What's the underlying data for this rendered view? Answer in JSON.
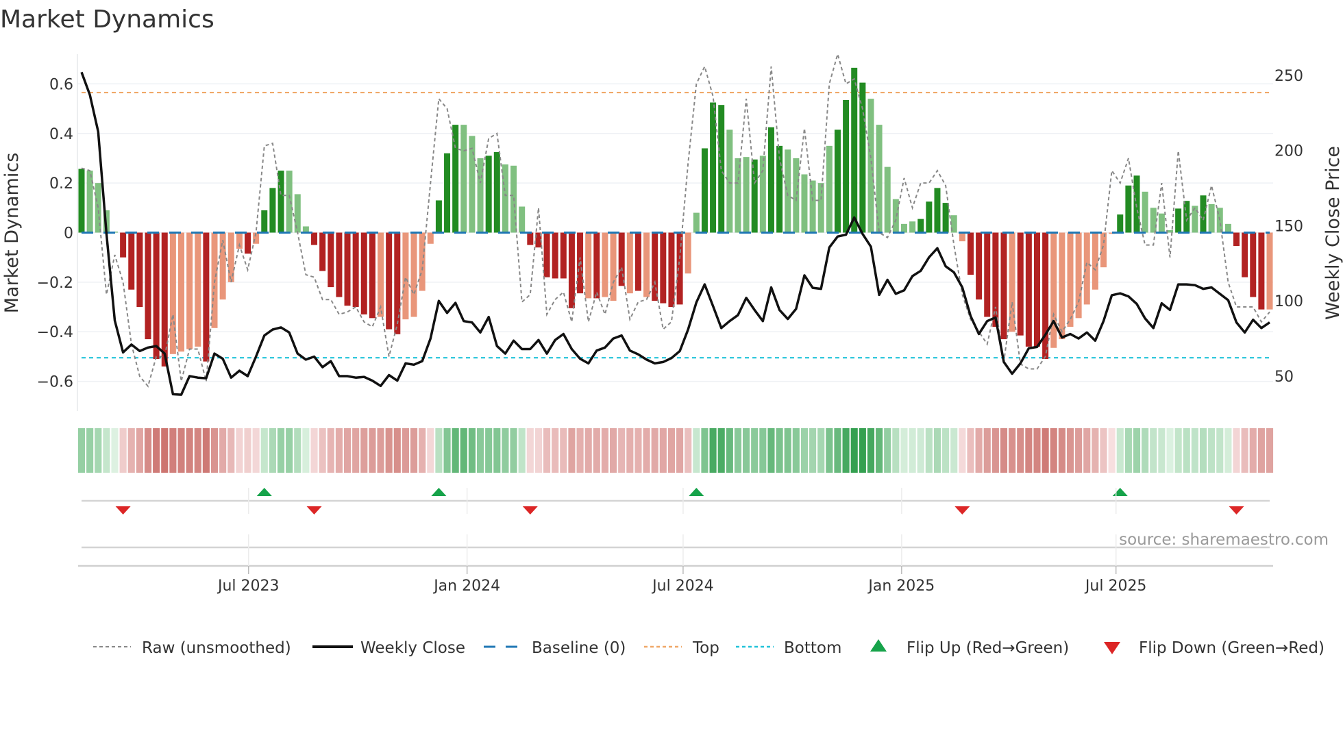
{
  "chart_data": {
    "type": "bar",
    "title": "Market Dynamics",
    "ylabel_left": "Market Dynamics",
    "ylabel_right": "Weekly Close Price",
    "ylim_left": [
      -0.72,
      0.72
    ],
    "ylim_right": [
      26.8,
      264
    ],
    "yticks_left": [
      {
        "value": 0.6,
        "label": "0.6"
      },
      {
        "value": 0.4,
        "label": "0.4"
      },
      {
        "value": 0.2,
        "label": "0.2"
      },
      {
        "value": 0,
        "label": "0"
      },
      {
        "value": -0.2,
        "label": "−0.2"
      },
      {
        "value": -0.4,
        "label": "−0.4"
      },
      {
        "value": -0.6,
        "label": "−0.6"
      }
    ],
    "yticks_right": [
      {
        "value": 50,
        "label": "50"
      },
      {
        "value": 100,
        "label": "100"
      },
      {
        "value": 150,
        "label": "150"
      },
      {
        "value": 200,
        "label": "200"
      },
      {
        "value": 250,
        "label": "250"
      }
    ],
    "x_unit": "week index",
    "x_ticks": [
      {
        "label": "Jul 2023",
        "week": 20.1
      },
      {
        "label": "Jan 2024",
        "week": 46.4
      },
      {
        "label": "Jul 2024",
        "week": 72.4
      },
      {
        "label": "Jan 2025",
        "week": 98.7
      },
      {
        "label": "Jul 2025",
        "week": 124.5
      }
    ],
    "grid": true,
    "momentum": [
      0.257,
      0.25,
      0.2,
      0.09,
      0.004,
      -0.1,
      -0.23,
      -0.3,
      -0.43,
      -0.51,
      -0.54,
      -0.49,
      -0.48,
      -0.47,
      -0.46,
      -0.52,
      -0.385,
      -0.27,
      -0.2,
      -0.065,
      -0.085,
      -0.045,
      0.09,
      0.18,
      0.25,
      0.25,
      0.155,
      0.025,
      -0.05,
      -0.155,
      -0.22,
      -0.26,
      -0.295,
      -0.3,
      -0.33,
      -0.345,
      -0.34,
      -0.39,
      -0.41,
      -0.35,
      -0.34,
      -0.235,
      -0.045,
      0.13,
      0.32,
      0.435,
      0.435,
      0.39,
      0.3,
      0.31,
      0.325,
      0.275,
      0.27,
      0.105,
      -0.05,
      -0.06,
      -0.18,
      -0.185,
      -0.185,
      -0.305,
      -0.245,
      -0.265,
      -0.265,
      -0.26,
      -0.275,
      -0.215,
      -0.245,
      -0.235,
      -0.26,
      -0.275,
      -0.285,
      -0.3,
      -0.29,
      -0.165,
      0.08,
      0.34,
      0.525,
      0.515,
      0.415,
      0.3,
      0.305,
      0.295,
      0.31,
      0.425,
      0.35,
      0.335,
      0.3,
      0.235,
      0.21,
      0.2,
      0.35,
      0.415,
      0.535,
      0.665,
      0.605,
      0.54,
      0.435,
      0.265,
      0.135,
      0.035,
      0.045,
      0.055,
      0.125,
      0.18,
      0.12,
      0.07,
      -0.035,
      -0.17,
      -0.27,
      -0.34,
      -0.38,
      -0.43,
      -0.4,
      -0.415,
      -0.46,
      -0.46,
      -0.51,
      -0.465,
      -0.43,
      -0.38,
      -0.345,
      -0.29,
      -0.23,
      -0.14,
      -0.005,
      0.073,
      0.19,
      0.23,
      0.165,
      0.1,
      0.077,
      0.01,
      0.097,
      0.128,
      0.108,
      0.15,
      0.115,
      0.1,
      0.035,
      -0.054,
      -0.18,
      -0.26,
      -0.31,
      -0.31
    ],
    "momentum_shade": "dllllddddddlllldlllldldddlllddddddddlddlllldddlllddllldddddddldlldldlddddllddd llldlddlllllldddd lllllldddd lldddddldddd lllllllldddllllddldlllddddl",
    "raw_unsmoothed": [
      0.26,
      0.25,
      0.1,
      -0.25,
      -0.09,
      -0.2,
      -0.45,
      -0.58,
      -0.62,
      -0.5,
      -0.5,
      -0.33,
      -0.6,
      -0.47,
      -0.47,
      -0.6,
      -0.2,
      -0.03,
      -0.2,
      -0.05,
      -0.15,
      0.0,
      0.35,
      0.36,
      0.15,
      0.15,
      0.0,
      -0.17,
      -0.18,
      -0.27,
      -0.27,
      -0.33,
      -0.32,
      -0.3,
      -0.36,
      -0.38,
      -0.3,
      -0.5,
      -0.37,
      -0.18,
      -0.25,
      -0.15,
      0.2,
      0.54,
      0.5,
      0.34,
      0.33,
      0.34,
      0.2,
      0.38,
      0.4,
      0.15,
      0.15,
      -0.28,
      -0.25,
      0.1,
      -0.33,
      -0.27,
      -0.24,
      -0.36,
      -0.1,
      -0.36,
      -0.24,
      -0.33,
      -0.2,
      -0.14,
      -0.35,
      -0.28,
      -0.27,
      -0.2,
      -0.39,
      -0.36,
      -0.1,
      0.28,
      0.6,
      0.67,
      0.55,
      0.25,
      0.2,
      0.2,
      0.54,
      0.2,
      0.25,
      0.67,
      0.3,
      0.15,
      0.13,
      0.42,
      0.13,
      0.13,
      0.6,
      0.72,
      0.6,
      0.62,
      0.5,
      0.3,
      0.0,
      -0.02,
      0.05,
      0.22,
      0.1,
      0.2,
      0.2,
      0.25,
      0.19,
      -0.05,
      -0.25,
      -0.35,
      -0.4,
      -0.45,
      -0.3,
      -0.52,
      -0.28,
      -0.53,
      -0.55,
      -0.55,
      -0.5,
      -0.33,
      -0.4,
      -0.35,
      -0.28,
      -0.12,
      -0.15,
      -0.05,
      0.25,
      0.2,
      0.3,
      0.1,
      -0.05,
      -0.05,
      0.2,
      -0.1,
      0.33,
      0.05,
      0.1,
      0.05,
      0.19,
      0.05,
      -0.2,
      -0.3,
      -0.3,
      -0.3,
      -0.36,
      -0.32
    ],
    "weekly_close": [
      252,
      237,
      212.5,
      144.6,
      87,
      65.8,
      71,
      66.7,
      69,
      70,
      65,
      38,
      37.7,
      50,
      49,
      48.6,
      65,
      61.6,
      49,
      53.6,
      50,
      63,
      77,
      81,
      82.4,
      79,
      65,
      61,
      63,
      56,
      60,
      50,
      50,
      49,
      49.5,
      47,
      43.5,
      50.7,
      47,
      58.5,
      57.6,
      60,
      75,
      100,
      92,
      98.7,
      86.6,
      85.7,
      79,
      89.3,
      70,
      65,
      73.6,
      68,
      68,
      74,
      65,
      74,
      78,
      68,
      61.6,
      58.5,
      67,
      69,
      75,
      77,
      67,
      64.5,
      61,
      58.5,
      59.4,
      62,
      66.7,
      81,
      99,
      111,
      96.6,
      82,
      86.6,
      90.6,
      102,
      94,
      86.6,
      109,
      94,
      88,
      94.7,
      117,
      108.7,
      108,
      135.5,
      142.8,
      144,
      155.4,
      144.6,
      136,
      104,
      114,
      104.7,
      107,
      116.5,
      120,
      129,
      135,
      123,
      119,
      109,
      90,
      78,
      86.6,
      89,
      59.4,
      51.6,
      58.5,
      68.5,
      69.4,
      77.5,
      86.6,
      75.7,
      78,
      75,
      79,
      73.6,
      86.6,
      103.8,
      105,
      103,
      98,
      88.4,
      82,
      98.4,
      94,
      111,
      111,
      110.5,
      108,
      109,
      104.7,
      100.5,
      85.7,
      79,
      87.5,
      82,
      85.7
    ],
    "baseline": 0,
    "top_level": 0.565,
    "bottom_level": -0.505,
    "flips_up": [
      22,
      43,
      74,
      125
    ],
    "flips_down": [
      5,
      28,
      54,
      106,
      139
    ],
    "legend_position": "bottom",
    "legend": [
      {
        "key": "raw",
        "label": "Raw (unsmoothed)"
      },
      {
        "key": "close",
        "label": "Weekly Close"
      },
      {
        "key": "baseline",
        "label": "Baseline (0)"
      },
      {
        "key": "top",
        "label": "Top"
      },
      {
        "key": "bottom",
        "label": "Bottom"
      },
      {
        "key": "flip_up",
        "label": "Flip Up (Red→Green)"
      },
      {
        "key": "flip_down",
        "label": "Flip Down (Green→Red)"
      }
    ],
    "source": "source: sharemaestro.com"
  },
  "colors": {
    "green_dark": "#228b22",
    "green_light": "#80c080",
    "red_dark": "#b22222",
    "red_light": "#e9967a",
    "raw": "#888888",
    "close": "#111111",
    "baseline": "#1f77b4",
    "top": "#f0a868",
    "bottom": "#22c3d9",
    "flip_up": "#16a34a",
    "flip_down": "#dc2626"
  }
}
